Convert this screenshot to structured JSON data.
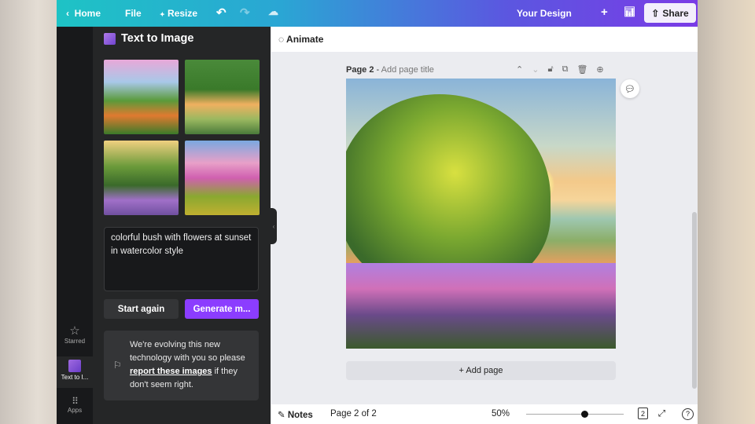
{
  "topbar": {
    "home": "Home",
    "file": "File",
    "resize": "Resize",
    "design_title": "Your Design",
    "share": "Share"
  },
  "rail": {
    "starred": "Starred",
    "text_to_image": "Text to I...",
    "apps": "Apps"
  },
  "panel": {
    "title": "Text to Image",
    "prompt": "colorful bush with flowers at sunset in watercolor style",
    "start_again": "Start again",
    "generate": "Generate m...",
    "notice_pre": "We're evolving this new technology with you so please ",
    "notice_link": "report these images",
    "notice_post": " if they don't seem right."
  },
  "toolbar": {
    "animate": "Animate"
  },
  "page": {
    "label": "Page 2",
    "title_placeholder": "Add page title",
    "add_page": "+ Add page"
  },
  "bottom": {
    "notes": "Notes",
    "page_indicator": "Page 2 of 2",
    "zoom": "50%",
    "zoom_fraction": 0.6,
    "page_count": "2"
  },
  "colors": {
    "accent": "#8b3dff"
  }
}
